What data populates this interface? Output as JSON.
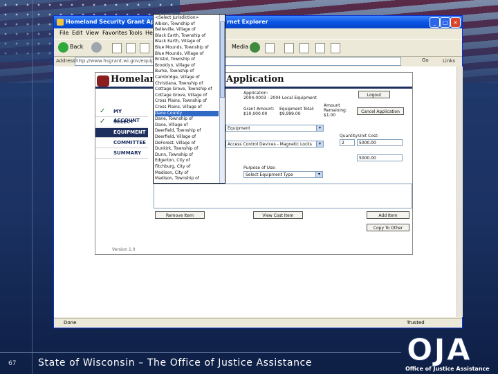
{
  "slide": {
    "number": "67",
    "footer": "State of Wisconsin – The Office of Justice Assistance",
    "logo_letters": "OJA",
    "logo_subtitle": "Office of Justice Assistance"
  },
  "browser": {
    "title_left": "Homeland Security Grant Applica",
    "title_right": "rnet Explorer",
    "menu": [
      "File",
      "Edit",
      "View",
      "Favorites",
      "Tools",
      "Help"
    ],
    "toolbar_back": "Back",
    "toolbar_media": "Media",
    "address_label": "Address",
    "address_value": "http://www.hsgrant.wi.gov/equipment.asp",
    "go_label": "Go",
    "links_label": "Links",
    "status_left": "Done",
    "status_right": "Trusted"
  },
  "app": {
    "title": "Homeland",
    "title_right": "Application",
    "nav": [
      {
        "label": "MY ACCOUNT",
        "checked": true
      },
      {
        "label": "SELECT GRANT",
        "checked": true
      },
      {
        "label": "EQUIPMENT",
        "checked": false
      },
      {
        "label": "COMMITTEE",
        "checked": false
      },
      {
        "label": "SUMMARY",
        "checked": false
      }
    ],
    "version": "Version 1.0",
    "application_label": "Application:",
    "application_value": "2004-0003 - 2004 Local Equipment",
    "grant_amount_label": "Grant Amount:",
    "grant_amount_value": "$10,000.00",
    "equipment_total_label": "Equipment Total:",
    "equipment_total_value": "$9,999.00",
    "amount_remaining_label": "Amount Remaining:",
    "amount_remaining_value": "$1.00",
    "logout_button": "Logout",
    "cancel_button": "Cancel Application",
    "category_select": "Equipment",
    "subcategory_select": "Access Control Devices - Magnetic Locks",
    "quantity_label": "Quantity:",
    "quantity_value": "2",
    "unit_cost_label": "Unit Cost:",
    "unit_cost_value": "5000.00",
    "total_value": "5000.00",
    "purpose_label": "Purpose of Use:",
    "purpose_select": "Select Equipment Type",
    "remove_button": "Remove Item",
    "view_button": "View Cost Item",
    "add_button": "Add Item",
    "copy_button": "Copy To Other"
  },
  "dropdown": {
    "items": [
      "<Select Jurisdiction>",
      "Albion, Township of",
      "Belleville, Village of",
      "Black Earth, Township of",
      "Black Earth, Village of",
      "Blue Mounds, Township of",
      "Blue Mounds, Village of",
      "Bristol, Township of",
      "Brooklyn, Village of",
      "Burke, Township of",
      "Cambridge, Village of",
      "Christiana, Township of",
      "Cottage Grove, Township of",
      "Cottage Grove, Village of",
      "Cross Plains, Township of",
      "Cross Plains, Village of",
      "Dane County",
      "Dane, Township of",
      "Dane, Village of",
      "Deerfield, Township of",
      "Deerfield, Village of",
      "DeForest, Village of",
      "Dunkirk, Township of",
      "Dunn, Township of",
      "Edgerton, City of",
      "Fitchburg, City of",
      "Madison, City of",
      "Madison, Township of"
    ],
    "selected_index": 16
  }
}
